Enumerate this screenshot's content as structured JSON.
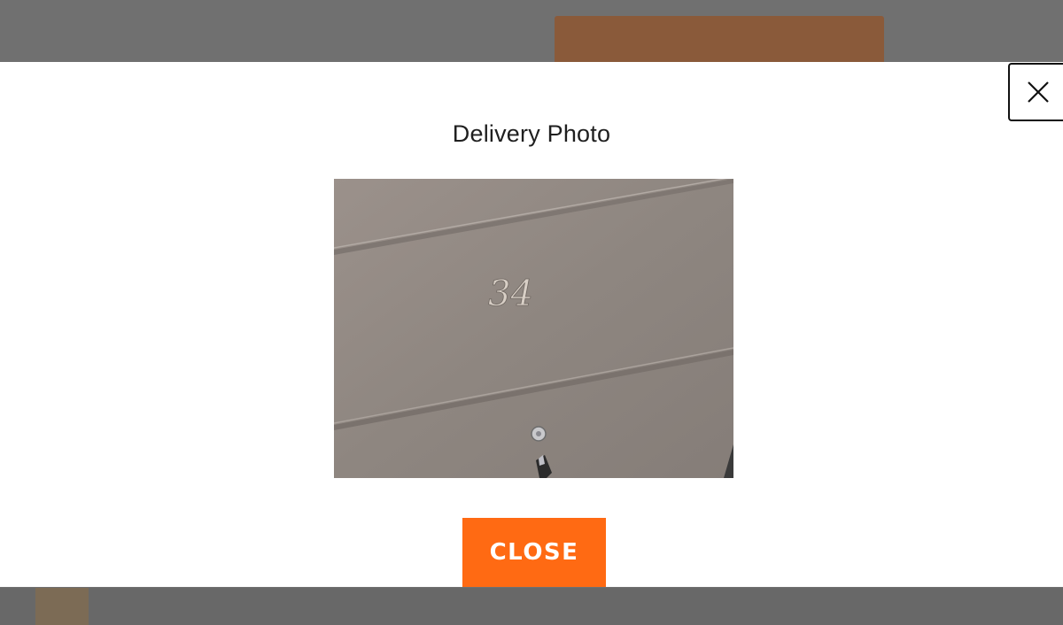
{
  "modal": {
    "title": "Delivery Photo",
    "close_button_label": "CLOSE",
    "close_icon": "close-icon"
  },
  "photo": {
    "door_number": "34"
  },
  "colors": {
    "accent": "#ff6a13",
    "overlay": "#707070",
    "modal_bg": "#ffffff"
  }
}
